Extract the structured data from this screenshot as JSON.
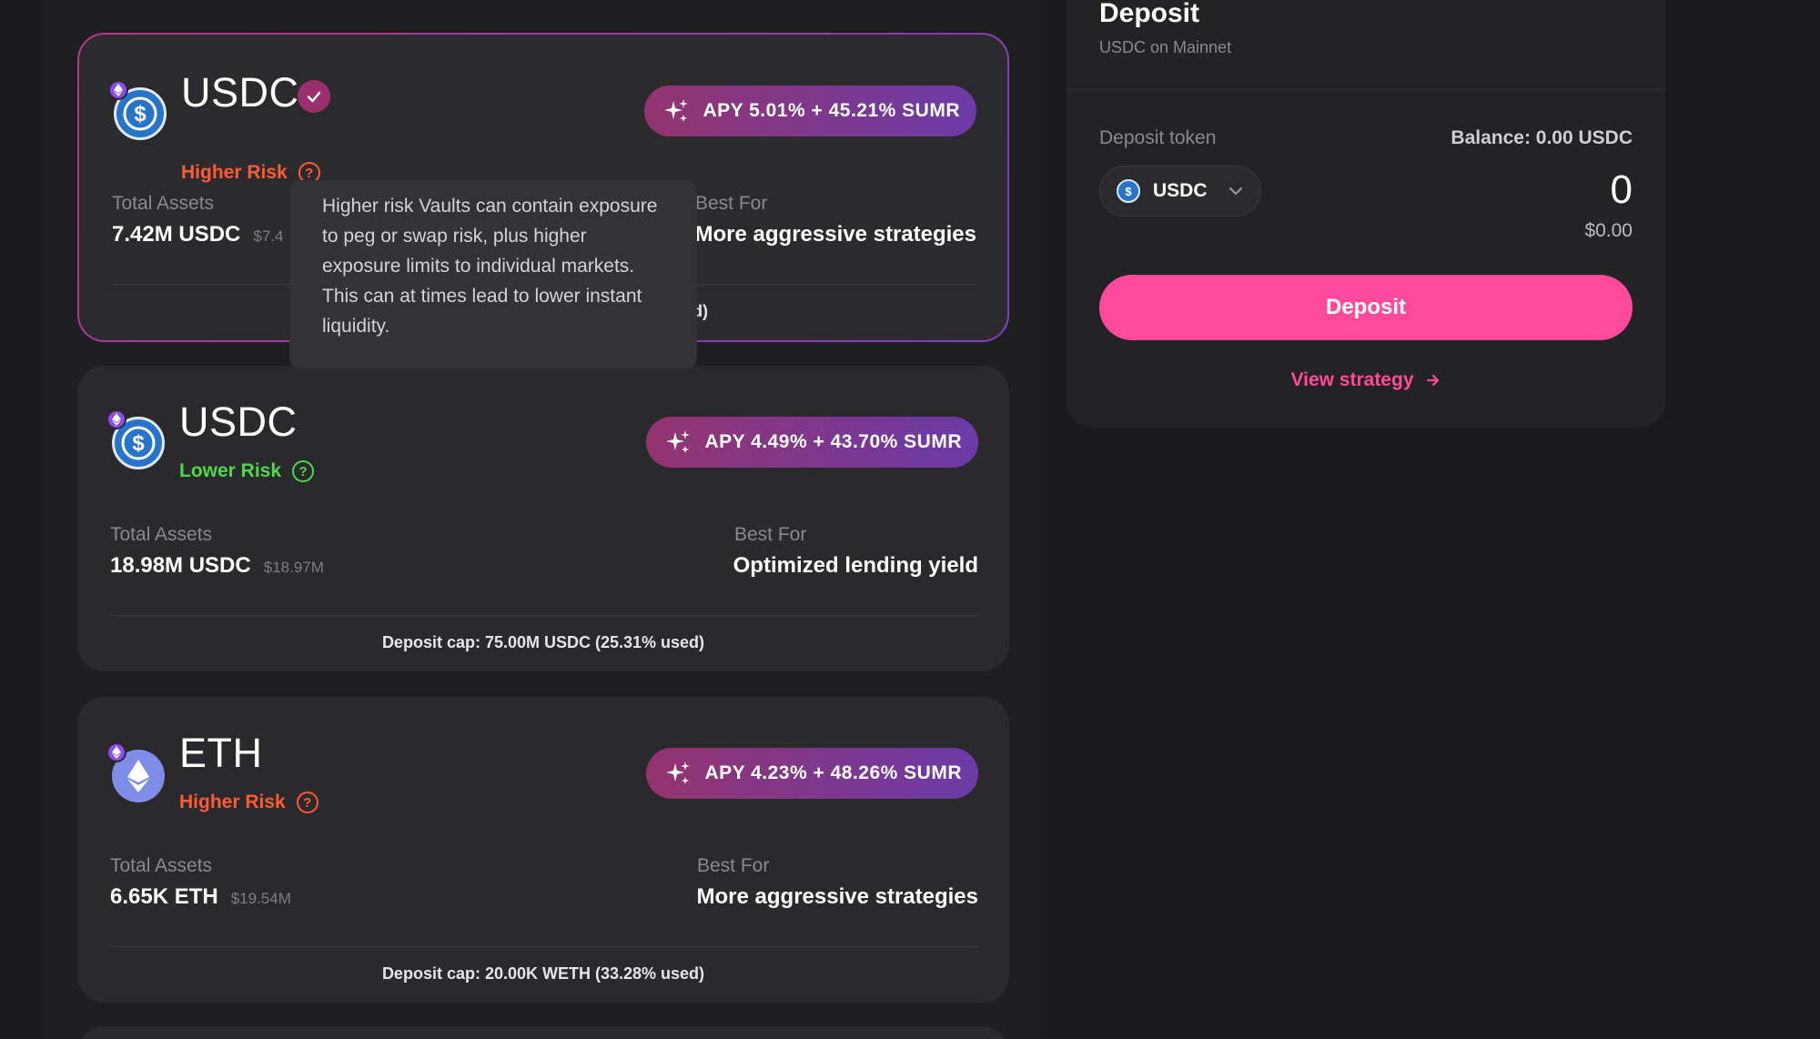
{
  "vaults": [
    {
      "token": "USDC",
      "risk": "Higher Risk",
      "apy": "APY 5.01% + 45.21% SUMR",
      "total_assets_label": "Total Assets",
      "total_assets": "7.42M USDC",
      "total_assets_usd": "$7.4",
      "best_for_label": "Best For",
      "best_for": "More aggressive strategies",
      "deposit_cap": "d)"
    },
    {
      "token": "USDC",
      "risk": "Lower Risk",
      "apy": "APY 4.49% + 43.70% SUMR",
      "total_assets_label": "Total Assets",
      "total_assets": "18.98M USDC",
      "total_assets_usd": "$18.97M",
      "best_for_label": "Best For",
      "best_for": "Optimized lending yield",
      "deposit_cap": "Deposit cap: 75.00M USDC (25.31% used)"
    },
    {
      "token": "ETH",
      "risk": "Higher Risk",
      "apy": "APY 4.23% + 48.26% SUMR",
      "total_assets_label": "Total Assets",
      "total_assets": "6.65K ETH",
      "total_assets_usd": "$19.54M",
      "best_for_label": "Best For",
      "best_for": "More aggressive strategies",
      "deposit_cap": "Deposit cap: 20.00K WETH (33.28% used)"
    }
  ],
  "tooltip": {
    "text": "Higher risk Vaults can contain exposure to peg or swap risk, plus higher exposure limits to individual markets. This can at times lead to lower instant liquidity."
  },
  "deposit_panel": {
    "title": "Deposit",
    "subtitle": "USDC on Mainnet",
    "token_label": "Deposit token",
    "balance": "Balance: 0.00 USDC",
    "selected_token": "USDC",
    "amount": "0",
    "amount_usd": "$0.00",
    "deposit_button": "Deposit",
    "view_strategy": "View strategy"
  },
  "colors": {
    "accent_pink": "#ff4a9c",
    "higher_risk": "#ff5a36",
    "lower_risk": "#4fd84b",
    "apy_gradient_start": "#93346f",
    "apy_gradient_end": "#6b3ba8"
  }
}
